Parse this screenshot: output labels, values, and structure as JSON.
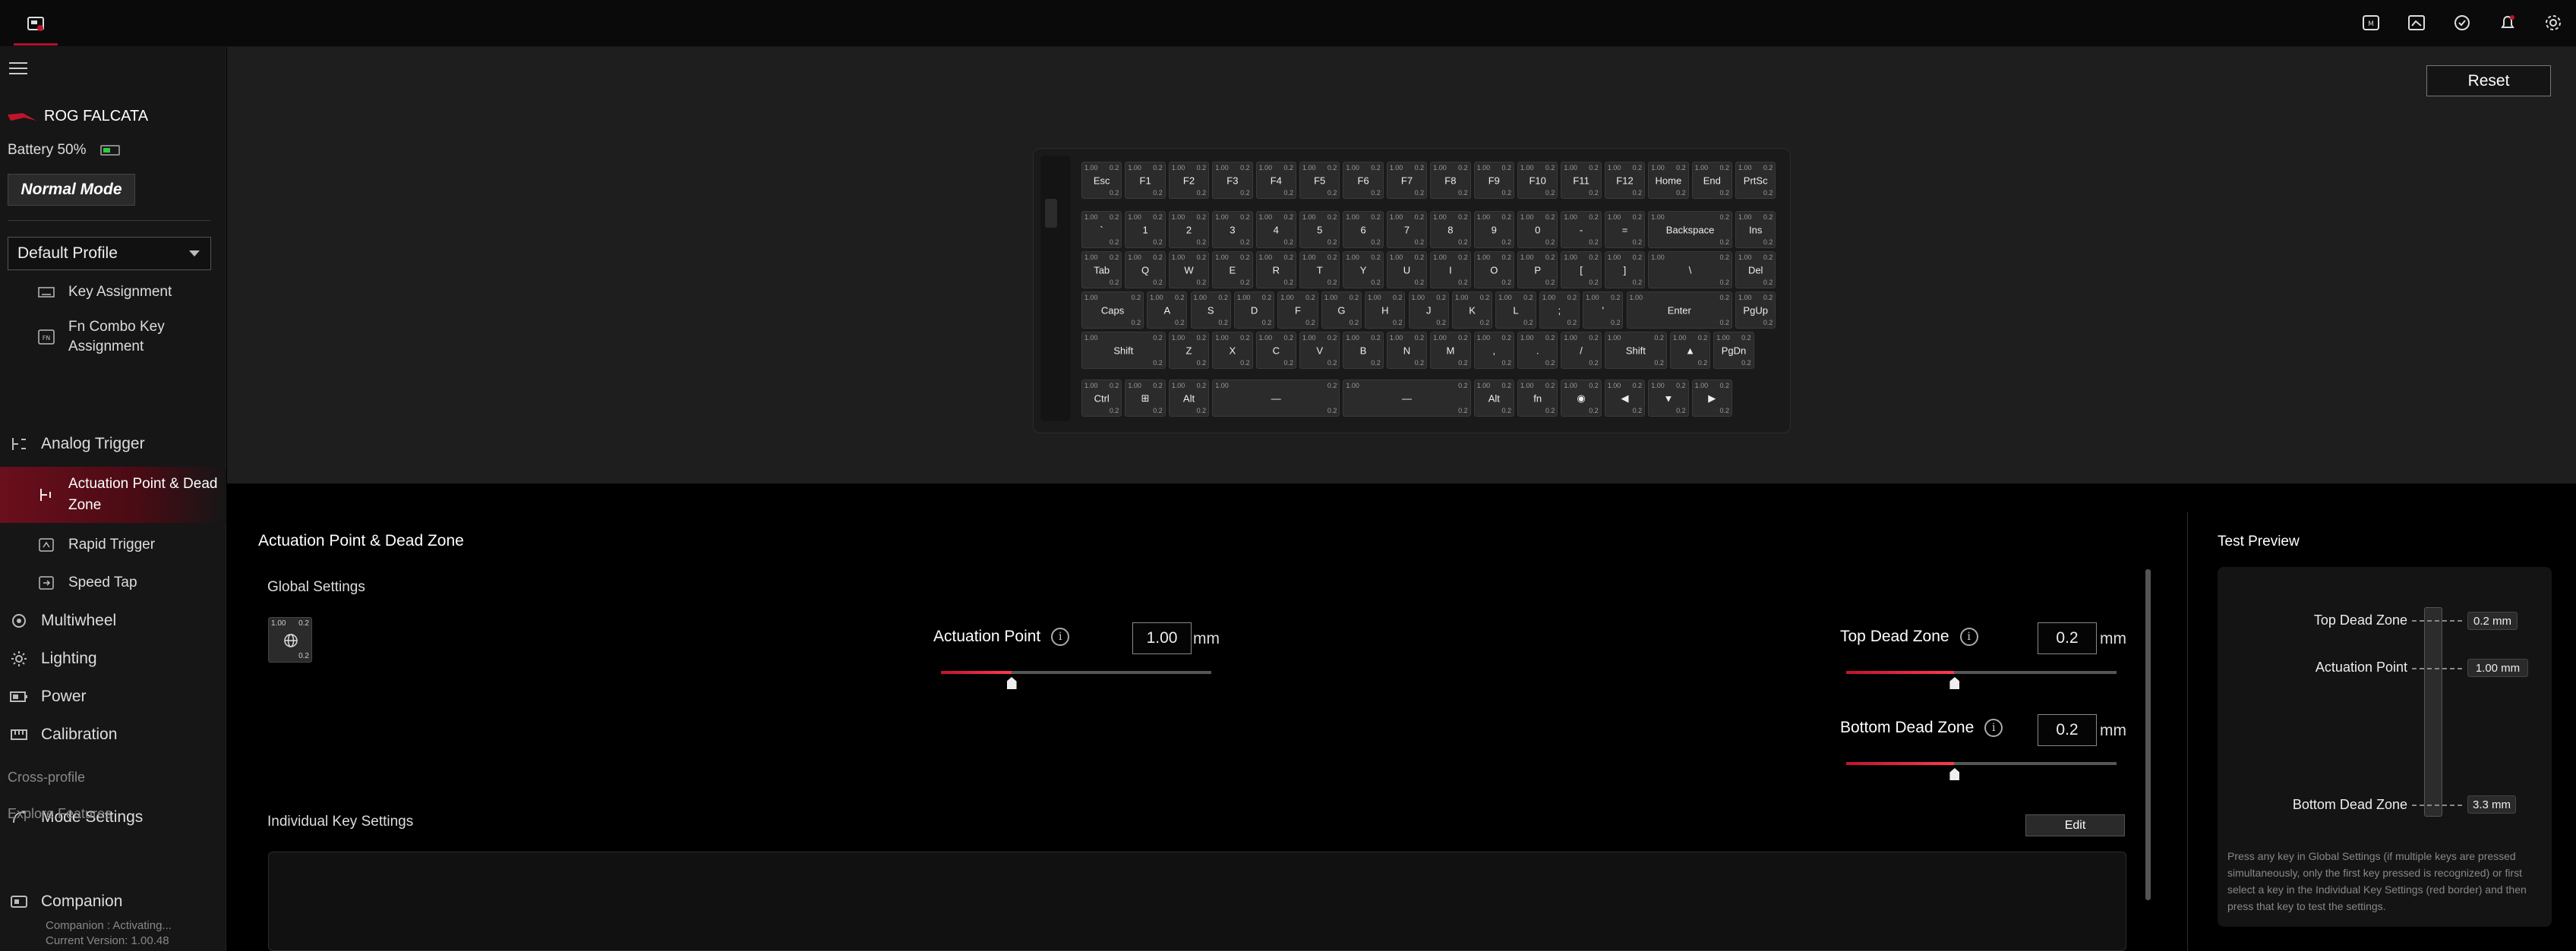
{
  "topbar": {
    "app_icon": "armoury-crate-icon",
    "icons": [
      "macro-icon",
      "screenshot-icon",
      "sync-icon",
      "notification-bell-icon",
      "settings-gear-icon"
    ]
  },
  "sidebar": {
    "device_name": "ROG FALCATA",
    "battery_label": "Battery 50%",
    "battery_level": 0.5,
    "mode_button": "Normal Mode",
    "profile_select": "Default Profile",
    "items": [
      {
        "label": "Key Assignment",
        "icon": "keyboard-icon"
      },
      {
        "label": "Fn Combo Key Assignment",
        "icon": "fn-key-icon"
      },
      {
        "label": "Analog Trigger",
        "icon": "analog-trigger-icon"
      },
      {
        "label": "Actuation Point & Dead Zone",
        "icon": "actuation-icon"
      },
      {
        "label": "Rapid Trigger",
        "icon": "rapid-trigger-icon"
      },
      {
        "label": "Speed Tap",
        "icon": "speed-tap-icon"
      },
      {
        "label": "Multiwheel",
        "icon": "multiwheel-icon"
      },
      {
        "label": "Lighting",
        "icon": "lighting-icon"
      },
      {
        "label": "Power",
        "icon": "power-icon"
      },
      {
        "label": "Calibration",
        "icon": "calibration-icon"
      },
      {
        "label": "Mode Settings",
        "icon": "mode-settings-icon"
      },
      {
        "label": "Companion",
        "icon": "companion-icon"
      }
    ],
    "section_cross_profile": "Cross-profile",
    "section_explore": "Explore Features",
    "companion_status": "Companion : Activating...",
    "current_version": "Current Version: 1.00.48"
  },
  "keyboard_area": {
    "reset_label": "Reset",
    "key_values": {
      "actuation": "1.00",
      "top_dz": "0.2",
      "bottom_dz": "0.2"
    },
    "rows": [
      [
        "Esc",
        "F1",
        "F2",
        "F3",
        "F4",
        "F5",
        "F6",
        "F7",
        "F8",
        "F9",
        "F10",
        "F11",
        "F12",
        "Home",
        "End",
        "PrtSc"
      ],
      [
        "`",
        "1",
        "2",
        "3",
        "4",
        "5",
        "6",
        "7",
        "8",
        "9",
        "0",
        "-",
        "=",
        "Backspace",
        "Ins"
      ],
      [
        "Tab",
        "Q",
        "W",
        "E",
        "R",
        "T",
        "Y",
        "U",
        "I",
        "O",
        "P",
        "[",
        "]",
        "\\",
        "Del"
      ],
      [
        "Caps",
        "A",
        "S",
        "D",
        "F",
        "G",
        "H",
        "J",
        "K",
        "L",
        ";",
        "'",
        "Enter",
        "PgUp"
      ],
      [
        "Shift",
        "Z",
        "X",
        "C",
        "V",
        "B",
        "N",
        "M",
        ",",
        ".",
        "/",
        "Shift",
        "▲",
        "PgDn"
      ],
      [
        "Ctrl",
        "⊞",
        "Alt",
        "—",
        "—",
        "Alt",
        "fn",
        "◉",
        "◀",
        "▼",
        "▶"
      ]
    ]
  },
  "settings": {
    "title": "Actuation Point & Dead Zone",
    "global_settings": "Global Settings",
    "global_key": {
      "actuation": "1.00",
      "top": "0.2",
      "bottom": "0.2",
      "icon": "globe-icon"
    },
    "actuation_point": {
      "label": "Actuation Point",
      "value": "1.00",
      "unit": "mm",
      "fraction": 0.26
    },
    "top_dead_zone": {
      "label": "Top Dead Zone",
      "value": "0.2",
      "unit": "mm",
      "fraction": 0.4
    },
    "bottom_dead_zone": {
      "label": "Bottom Dead Zone",
      "value": "0.2",
      "unit": "mm",
      "fraction": 0.4
    },
    "individual_key_settings": "Individual Key Settings",
    "edit_label": "Edit"
  },
  "test_preview": {
    "title": "Test Preview",
    "top_dead_zone_label": "Top Dead Zone",
    "top_dead_zone_value": "0.2 mm",
    "actuation_point_label": "Actuation Point",
    "actuation_point_value": "1.00 mm",
    "bottom_dead_zone_label": "Bottom Dead Zone",
    "bottom_dead_zone_value": "3.3 mm",
    "note": "Press any key in Global Settings (if multiple keys are pressed simultaneously, only the first key pressed is recognized) or first select a key in the Individual Key Settings (red border) and then press that key to test the settings."
  }
}
